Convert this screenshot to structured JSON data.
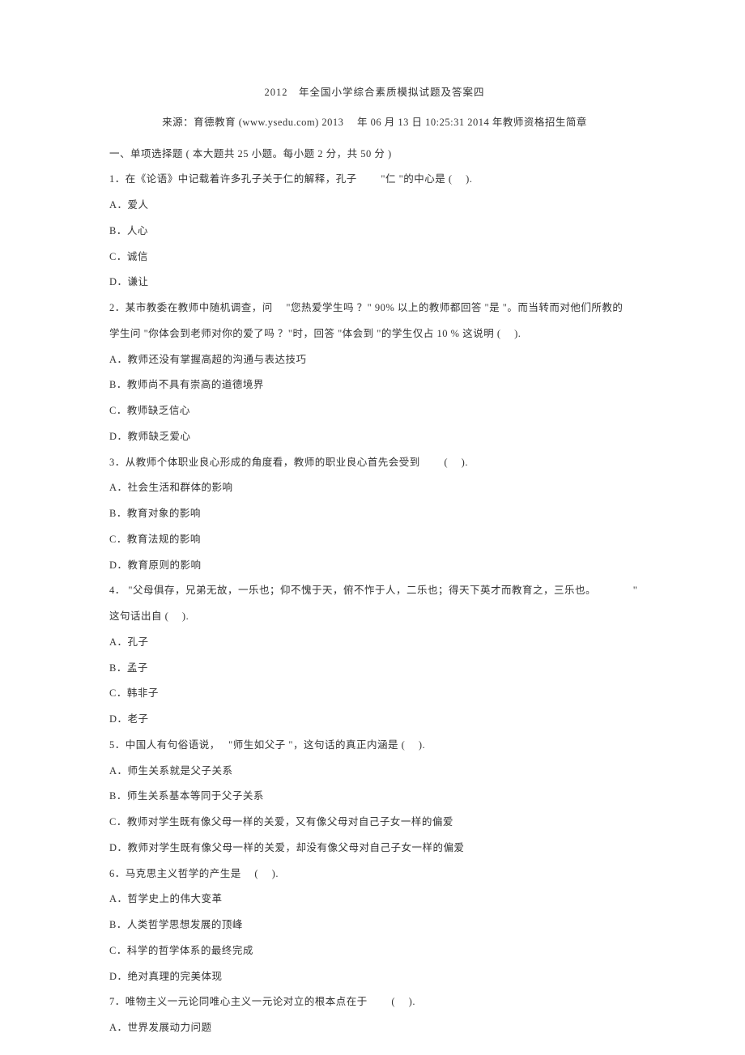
{
  "title": "2012　年全国小学综合素质模拟试题及答案四",
  "source": "来源：育德教育 (www.ysedu.com) 2013　 年 06 月 13 日  10:25:31 2014 年教师资格招生简章",
  "section": "一、单项选择题 ( 本大题共  25 小题。每小题   2 分，共  50 分 )",
  "q1": {
    "stem": "1．在《论语》中记载着许多孔子关于仁的解释，孔子　　 \"仁 \"的中心是 (　   ).",
    "a": "A．爱人",
    "b": "B．人心",
    "c": "C．诚信",
    "d": "D．谦让"
  },
  "q2": {
    "stem1": "2．某市教委在教师中随机调查，问　   \"您热爱学生吗   ？\"  90% 以上的教师都回答    \"是 \"。而当转而对他们所教的",
    "stem2": "学生问  \"你体会到老师对你的爱了吗    ？\"时，回答   \"体会到 \"的学生仅占  10 % 这说明 (　   ).",
    "a": "A．教师还没有掌握高超的沟通与表达技巧",
    "b": "B．教师尚不具有崇高的道德境界",
    "c": "C．教师缺乏信心",
    "d": "D．教师缺乏爱心"
  },
  "q3": {
    "stem": "3．从教师个体职业良心形成的角度看，教师的职业良心首先会受到　　   (　   ).",
    "a": "A．社会生活和群体的影响",
    "b": "B．教育对象的影响",
    "c": "C．教育法规的影响",
    "d": "D．教育原则的影响"
  },
  "q4": {
    "stem1": "4．  \"父母俱存，兄弟无故，一乐也；仰不愧于天，俯不怍于人，二乐也；得天下英才而教育之，三乐也。　　　　\"",
    "stem2": "这句话出自 (　   ).",
    "a": "A．孔子",
    "b": "B．孟子",
    "c": "C．韩非子",
    "d": "D．老子"
  },
  "q5": {
    "stem": "5．中国人有句俗语说，　   \"师生如父子  \"，这句话的真正内涵是   (　   ).",
    "a": "A．师生关系就是父子关系",
    "b": "B．师生关系基本等同于父子关系",
    "c": "C．教师对学生既有像父母一样的关爱，又有像父母对自己子女一样的偏爱",
    "d": "D．教师对学生既有像父母一样的关爱，却没有像父母对自己子女一样的偏爱"
  },
  "q6": {
    "stem": "6．马克思主义哲学的产生是　  (　   ).",
    "a": "A．哲学史上的伟大变革",
    "b": "B．人类哲学思想发展的顶峰",
    "c": "C．科学的哲学体系的最终完成",
    "d": "D．绝对真理的完美体现"
  },
  "q7": {
    "stem": "7．唯物主义一元论同唯心主义一元论对立的根本点在于　　   (　   ).",
    "a": "A．世界发展动力问题"
  }
}
